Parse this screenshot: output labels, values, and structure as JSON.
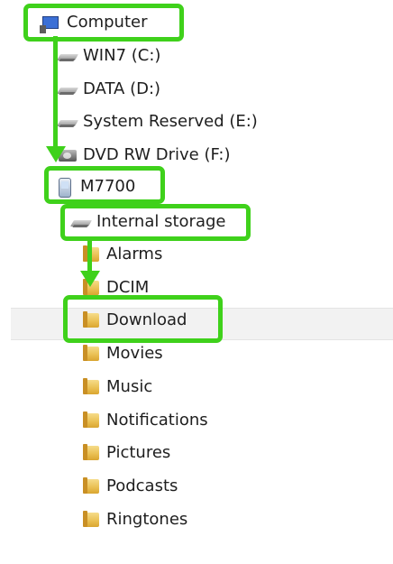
{
  "tree": {
    "computer": "Computer",
    "drives": [
      "WIN7 (C:)",
      "DATA (D:)",
      "System Reserved (E:)",
      "DVD RW Drive (F:)"
    ],
    "device": "M7700",
    "storage": "Internal storage",
    "folders": [
      "Alarms",
      "DCIM",
      "Download",
      "Movies",
      "Music",
      "Notifications",
      "Pictures",
      "Podcasts",
      "Ringtones"
    ],
    "selected": "Download"
  },
  "colors": {
    "highlight": "#3fd11b",
    "selected_row": "#f2f2f2"
  }
}
